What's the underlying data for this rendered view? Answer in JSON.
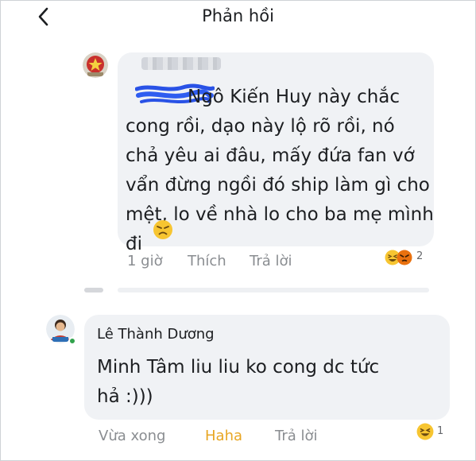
{
  "header": {
    "title": "Phản hồi"
  },
  "comment1": {
    "author_blurred": "",
    "text_first_line": "Ngô Kiến Huy này chắc",
    "text_rest": "cong rồi, dạo này lộ rõ rồi, nó\nchả yêu ai đâu, mấy đứa fan vớ\nvẩn đừng ngồi đó ship làm gì cho\nmệt, lo về nhà lo cho ba mẹ mình\nđi",
    "time": "1 giờ",
    "like_label": "Thích",
    "reply_label": "Trả lời",
    "reaction_count": "2",
    "reaction_icons": [
      "haha-icon",
      "angry-icon"
    ]
  },
  "comment2": {
    "author": "Lê Thành Dương",
    "text": "Minh Tâm liu liu ko cong dc tức\nhả :)))",
    "time": "Vừa xong",
    "reaction_label": "Haha",
    "reply_label": "Trả lời",
    "reaction_count": "1",
    "reaction_icons": [
      "haha-icon"
    ]
  },
  "colors": {
    "bubble": "#f0f2f5",
    "meta_text": "#8a8d91",
    "haha_active": "#e8a623",
    "online": "#31a24c"
  }
}
